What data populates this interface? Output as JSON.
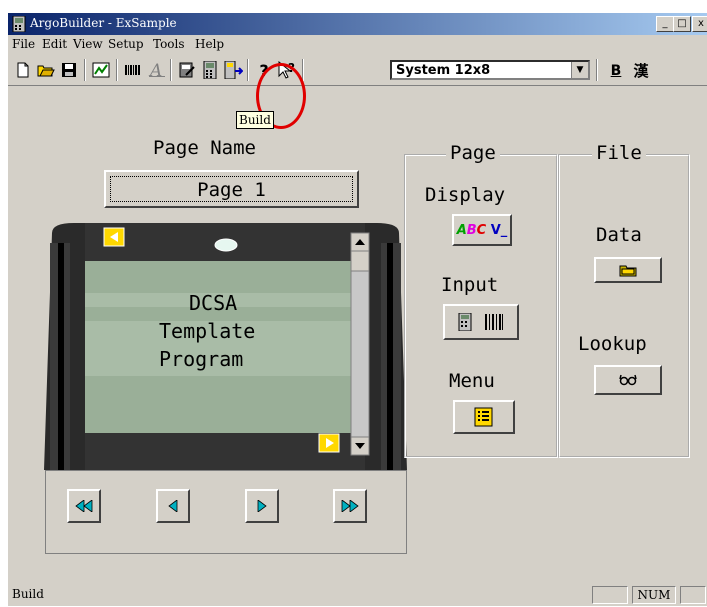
{
  "window": {
    "title": "ArgoBuilder - ExSample",
    "min_label": "_",
    "max_label": "□",
    "close_label": "x"
  },
  "menu": [
    "File",
    "Edit",
    "View",
    "Setup",
    "Tools",
    "Help"
  ],
  "toolbar": {
    "font_select": "System 12x8",
    "bold_label": "B",
    "kanji_label": "漢",
    "help_label": "?",
    "tooltip": "Build"
  },
  "page_name": {
    "label": "Page Name",
    "button": "Page 1"
  },
  "screen": {
    "lines": [
      "DCSA",
      "Template",
      "Program"
    ]
  },
  "page_group": {
    "title": "Page",
    "display": "Display",
    "input": "Input",
    "menu": "Menu",
    "display_icon_text": "ABC V_"
  },
  "file_group": {
    "title": "File",
    "data": "Data",
    "lookup": "Lookup"
  },
  "status": {
    "text": "Build",
    "num": "NUM"
  },
  "colors": {
    "accent_red": "#e00000",
    "title_blue": "#0a246a",
    "screen_green": "#9aaf98"
  }
}
